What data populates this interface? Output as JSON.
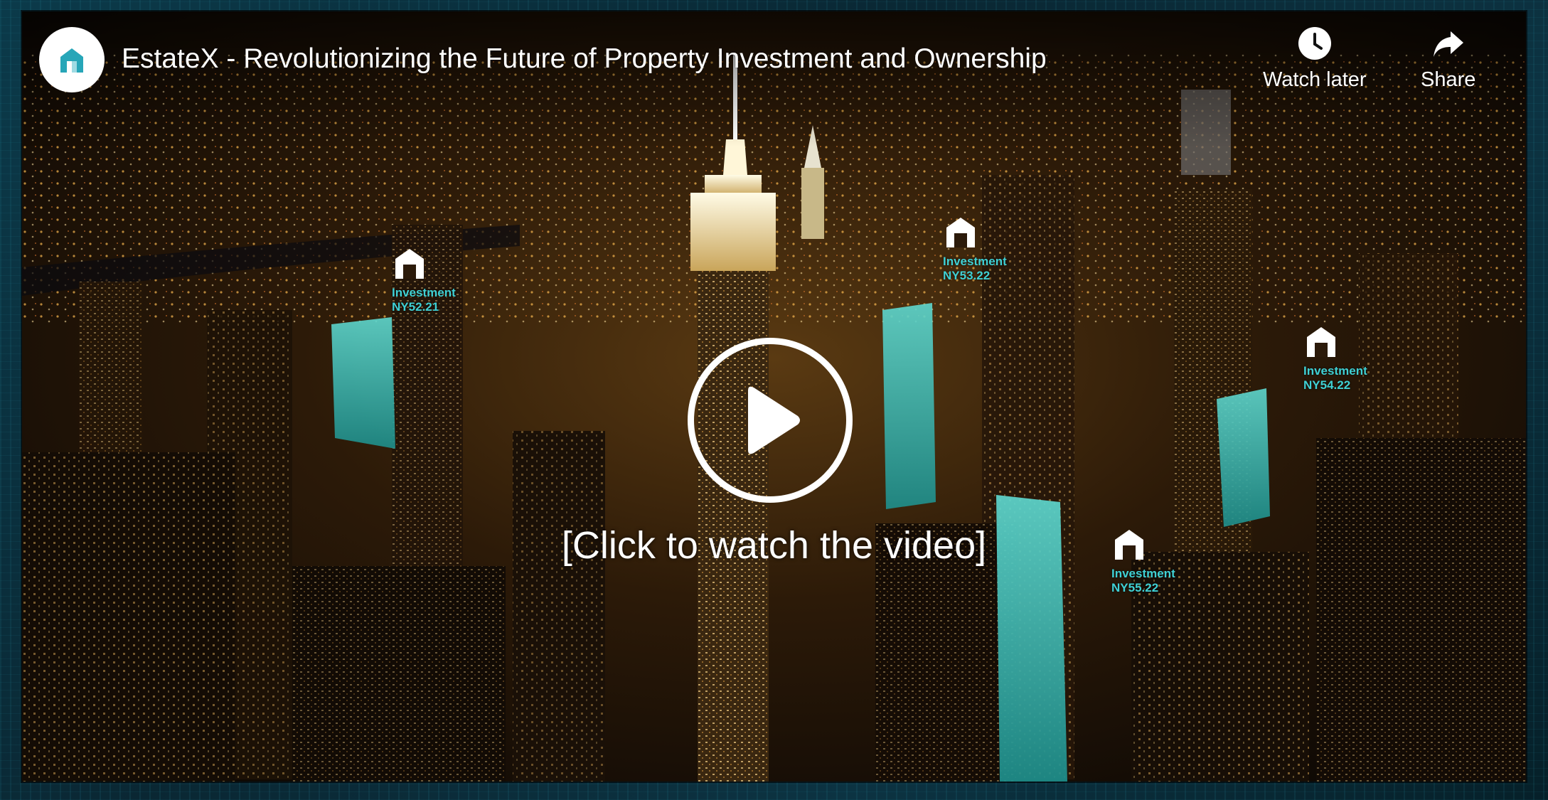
{
  "video": {
    "title": "EstateX - Revolutionizing the Future of Property Investment and Ownership",
    "cta": "[Click to watch the video]"
  },
  "actions": {
    "watch_later": "Watch later",
    "share": "Share"
  },
  "markers": [
    {
      "label": "Investment",
      "code": "NY52.21"
    },
    {
      "label": "Investment",
      "code": "NY53.22"
    },
    {
      "label": "Investment",
      "code": "NY54.22"
    },
    {
      "label": "Investment",
      "code": "NY55.22"
    }
  ],
  "colors": {
    "accent_teal": "#3fd0d4",
    "background": "#0a0704",
    "frame": "#0b3a4a"
  },
  "icons": {
    "logo": "estatex-house-icon",
    "watch_later": "clock-icon",
    "share": "share-arrow-icon",
    "play": "play-icon",
    "marker": "house-marker-icon"
  }
}
